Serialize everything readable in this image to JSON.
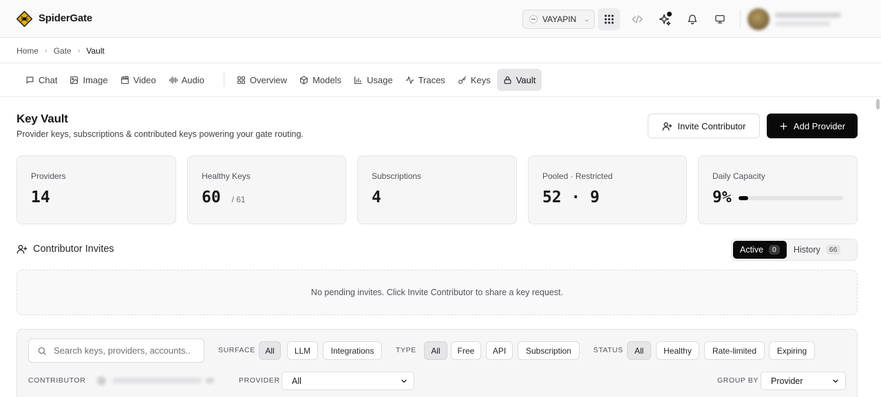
{
  "app": {
    "brand": "SpiderGate",
    "org_switcher": "VAYAPIN"
  },
  "breadcrumb": [
    "Home",
    "Gate",
    "Vault"
  ],
  "tabs": [
    {
      "label": "Chat",
      "icon": "message-square-icon"
    },
    {
      "label": "Image",
      "icon": "image-icon"
    },
    {
      "label": "Video",
      "icon": "clapperboard-icon"
    },
    {
      "label": "Audio",
      "icon": "audio-lines-icon"
    },
    {
      "label": "Overview",
      "icon": "layout-grid-icon"
    },
    {
      "label": "Models",
      "icon": "box-icon"
    },
    {
      "label": "Usage",
      "icon": "bar-chart-icon"
    },
    {
      "label": "Traces",
      "icon": "activity-icon"
    },
    {
      "label": "Keys",
      "icon": "key-icon"
    },
    {
      "label": "Vault",
      "icon": "lock-icon",
      "active": true
    }
  ],
  "header": {
    "title": "Key Vault",
    "subtitle": "Provider keys, subscriptions & contributed keys powering your gate routing.",
    "invite_label": "Invite Contributor",
    "add_label": "Add Provider"
  },
  "stats": {
    "providers": {
      "label": "Providers",
      "value": "14"
    },
    "healthy": {
      "label": "Healthy Keys",
      "value": "60",
      "total": "/ 61"
    },
    "subscriptions": {
      "label": "Subscriptions",
      "value": "4"
    },
    "pooled": {
      "label": "Pooled · Restricted",
      "value": "52 · 9"
    },
    "capacity": {
      "label": "Daily Capacity",
      "value": "9%",
      "fraction": 0.09
    }
  },
  "contributors": {
    "title": "Contributor Invites",
    "active_label": "Active",
    "active_count": "0",
    "history_label": "History",
    "history_count": "66",
    "empty_text": "No pending invites. Click Invite Contributor to share a key request."
  },
  "filters": {
    "search_placeholder": "Search keys, providers, accounts...",
    "surface": {
      "label": "SURFACE",
      "options": [
        "All",
        "LLM",
        "Integrations"
      ],
      "selected": "All"
    },
    "type": {
      "label": "TYPE",
      "options": [
        "All",
        "Free",
        "API",
        "Subscription"
      ],
      "selected": "All"
    },
    "status": {
      "label": "STATUS",
      "options": [
        "All",
        "Healthy",
        "Rate-limited",
        "Expiring"
      ],
      "selected": "All"
    },
    "contributor_label": "CONTRIBUTOR",
    "provider_label": "PROVIDER",
    "provider_value": "All",
    "groupby_label": "GROUP BY",
    "groupby_value": "Provider"
  },
  "colors": {
    "accent": "#0a0a0a",
    "logo": "#e3b112",
    "surface": "#f6f6f7"
  }
}
